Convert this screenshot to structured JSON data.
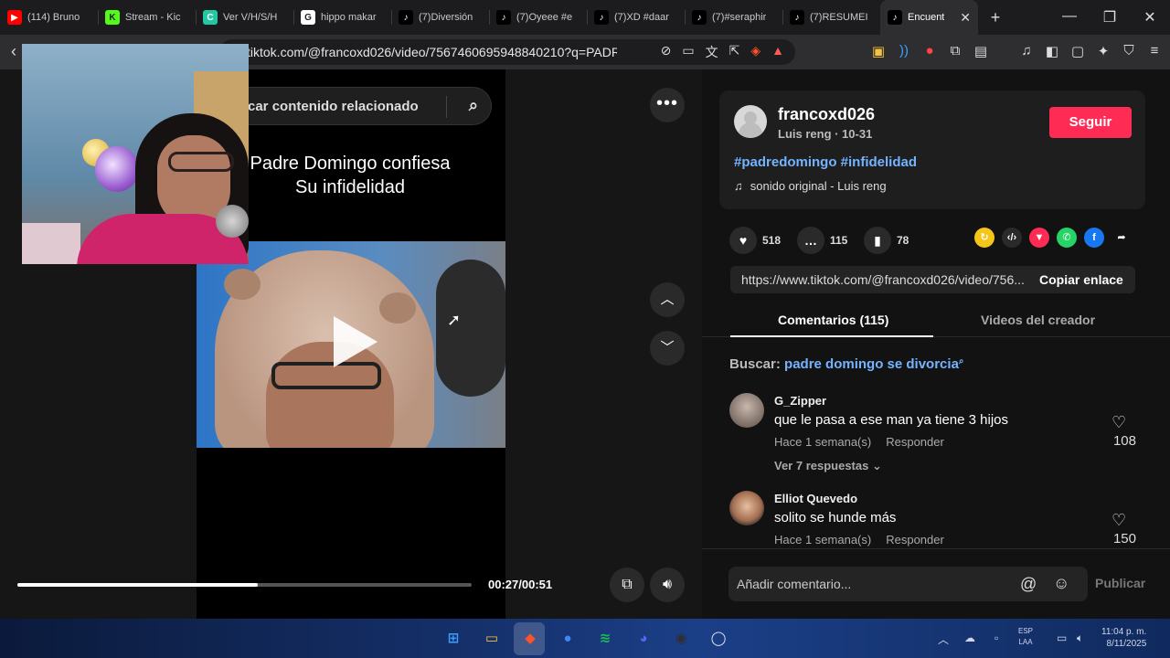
{
  "browser": {
    "tabs": [
      {
        "label": "(114) Bruno",
        "icon": "youtube-icon",
        "color": "#ff0000",
        "glyph": "▶"
      },
      {
        "label": "Stream - Kic",
        "icon": "kick-icon",
        "color": "#53fc18",
        "glyph": "K"
      },
      {
        "label": "Ver V/H/S/H",
        "icon": "cuevana-icon",
        "color": "#24c7a4",
        "glyph": "C"
      },
      {
        "label": "hippo makar",
        "icon": "google-icon",
        "color": "#ffffff",
        "glyph": "G"
      },
      {
        "label": "(7)Diversión",
        "icon": "tiktok-icon",
        "color": "#000000",
        "glyph": "♪"
      },
      {
        "label": "(7)Oyeee #e",
        "icon": "tiktok-icon",
        "color": "#000000",
        "glyph": "♪"
      },
      {
        "label": "(7)XD #daar",
        "icon": "tiktok-icon",
        "color": "#000000",
        "glyph": "♪"
      },
      {
        "label": "(7)#seraphir",
        "icon": "tiktok-icon",
        "color": "#000000",
        "glyph": "♪"
      },
      {
        "label": "(7)RESUMEI",
        "icon": "tiktok-icon",
        "color": "#000000",
        "glyph": "♪"
      },
      {
        "label": "Encuent",
        "icon": "tiktok-icon",
        "color": "#000000",
        "glyph": "♪",
        "active": true
      }
    ],
    "url": "tiktok.com/@francoxd026/video/7567460695948840210?q=PADRE..."
  },
  "video": {
    "search_placeholder": "car contenido relacionado",
    "title_line1": "Padre Domingo confiesa",
    "title_line2": "Su infidelidad",
    "progress_fraction": 0.53,
    "time": "00:27/00:51"
  },
  "author": {
    "username": "francoxd026",
    "subline": "Luis reng · 10-31",
    "follow_label": "Seguir",
    "hashtags": "#padredomingo #infidelidad",
    "sound": "sonido original - Luis reng"
  },
  "stats": {
    "likes": "518",
    "comments": "115",
    "saves": "78"
  },
  "share_icons": [
    {
      "name": "repost-icon",
      "color": "#f5c518",
      "glyph": "↻"
    },
    {
      "name": "embed-icon",
      "color": "#2a2a2a",
      "glyph": "‹/›"
    },
    {
      "name": "send-icon",
      "color": "#fe2c55",
      "glyph": "▼"
    },
    {
      "name": "whatsapp-icon",
      "color": "#25d366",
      "glyph": "✆"
    },
    {
      "name": "facebook-icon",
      "color": "#1877f2",
      "glyph": "f"
    },
    {
      "name": "share-arrow-icon",
      "color": "#121212",
      "glyph": "➦"
    }
  ],
  "link": {
    "url": "https://www.tiktok.com/@francoxd026/video/756...",
    "copy_label": "Copiar enlace"
  },
  "tabs": {
    "comments": "Comentarios (115)",
    "videos": "Videos del creador"
  },
  "search_suggest": {
    "prefix": "Buscar: ",
    "query": "padre domingo se divorcia"
  },
  "comments": [
    {
      "name": "G_Zipper",
      "text": "que le pasa a ese man ya tiene 3 hijos",
      "time": "Hace 1 semana(s)",
      "reply": "Responder",
      "likes": "108",
      "more": "Ver 7 respuestas"
    },
    {
      "name": "Elliot Quevedo",
      "text": "solito se hunde más",
      "time": "Hace 1 semana(s)",
      "reply": "Responder",
      "likes": "150"
    }
  ],
  "compose": {
    "placeholder": "Añadir comentario...",
    "publish": "Publicar"
  },
  "taskbar": {
    "apps": [
      {
        "name": "windows-start-icon",
        "color": "#3aa0ff",
        "glyph": "⊞"
      },
      {
        "name": "file-explorer-icon",
        "color": "#f4c23c",
        "glyph": "▭"
      },
      {
        "name": "brave-icon",
        "color": "#fb542b",
        "glyph": "◆"
      },
      {
        "name": "chrome-icon",
        "color": "#4285f4",
        "glyph": "●"
      },
      {
        "name": "spotify-icon",
        "color": "#1db954",
        "glyph": "≋"
      },
      {
        "name": "discord-icon",
        "color": "#5865f2",
        "glyph": "◕"
      },
      {
        "name": "obs-icon",
        "color": "#302e31",
        "glyph": "◉"
      },
      {
        "name": "app-icon",
        "color": "#e8e8e8",
        "glyph": "◯"
      }
    ],
    "lang_line1": "ESP",
    "lang_line2": "LAA",
    "time": "11:04 p. m.",
    "date": "8/11/2025"
  }
}
